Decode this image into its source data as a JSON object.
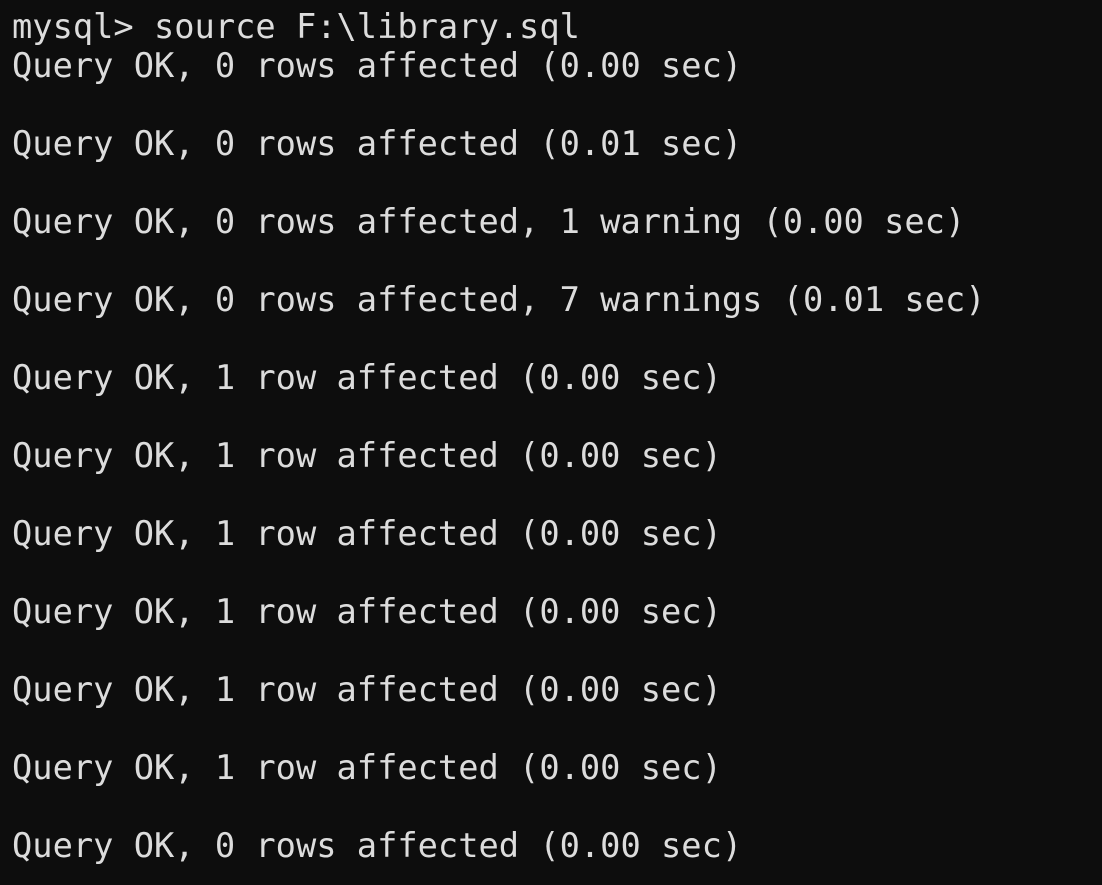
{
  "terminal": {
    "app": "mysql-client-console",
    "colors": {
      "background": "#0d0d0d",
      "foreground": "#dcdcdc"
    },
    "prompt": "mysql>",
    "command": "source F:\\library.sql",
    "lines": [
      {
        "id": "command-line",
        "text": "mysql> source F:\\library.sql",
        "blank": false
      },
      {
        "id": "result-1",
        "text": "Query OK, 0 rows affected (0.00 sec)",
        "blank": false
      },
      {
        "id": "spacer-1",
        "text": "",
        "blank": true
      },
      {
        "id": "result-2",
        "text": "Query OK, 0 rows affected (0.01 sec)",
        "blank": false
      },
      {
        "id": "spacer-2",
        "text": "",
        "blank": true
      },
      {
        "id": "result-3",
        "text": "Query OK, 0 rows affected, 1 warning (0.00 sec)",
        "blank": false
      },
      {
        "id": "spacer-3",
        "text": "",
        "blank": true
      },
      {
        "id": "result-4",
        "text": "Query OK, 0 rows affected, 7 warnings (0.01 sec)",
        "blank": false
      },
      {
        "id": "spacer-4",
        "text": "",
        "blank": true
      },
      {
        "id": "result-5",
        "text": "Query OK, 1 row affected (0.00 sec)",
        "blank": false
      },
      {
        "id": "spacer-5",
        "text": "",
        "blank": true
      },
      {
        "id": "result-6",
        "text": "Query OK, 1 row affected (0.00 sec)",
        "blank": false
      },
      {
        "id": "spacer-6",
        "text": "",
        "blank": true
      },
      {
        "id": "result-7",
        "text": "Query OK, 1 row affected (0.00 sec)",
        "blank": false
      },
      {
        "id": "spacer-7",
        "text": "",
        "blank": true
      },
      {
        "id": "result-8",
        "text": "Query OK, 1 row affected (0.00 sec)",
        "blank": false
      },
      {
        "id": "spacer-8",
        "text": "",
        "blank": true
      },
      {
        "id": "result-9",
        "text": "Query OK, 1 row affected (0.00 sec)",
        "blank": false
      },
      {
        "id": "spacer-9",
        "text": "",
        "blank": true
      },
      {
        "id": "result-10",
        "text": "Query OK, 1 row affected (0.00 sec)",
        "blank": false
      },
      {
        "id": "spacer-10",
        "text": "",
        "blank": true
      },
      {
        "id": "result-11",
        "text": "Query OK, 0 rows affected (0.00 sec)",
        "blank": false
      }
    ]
  }
}
